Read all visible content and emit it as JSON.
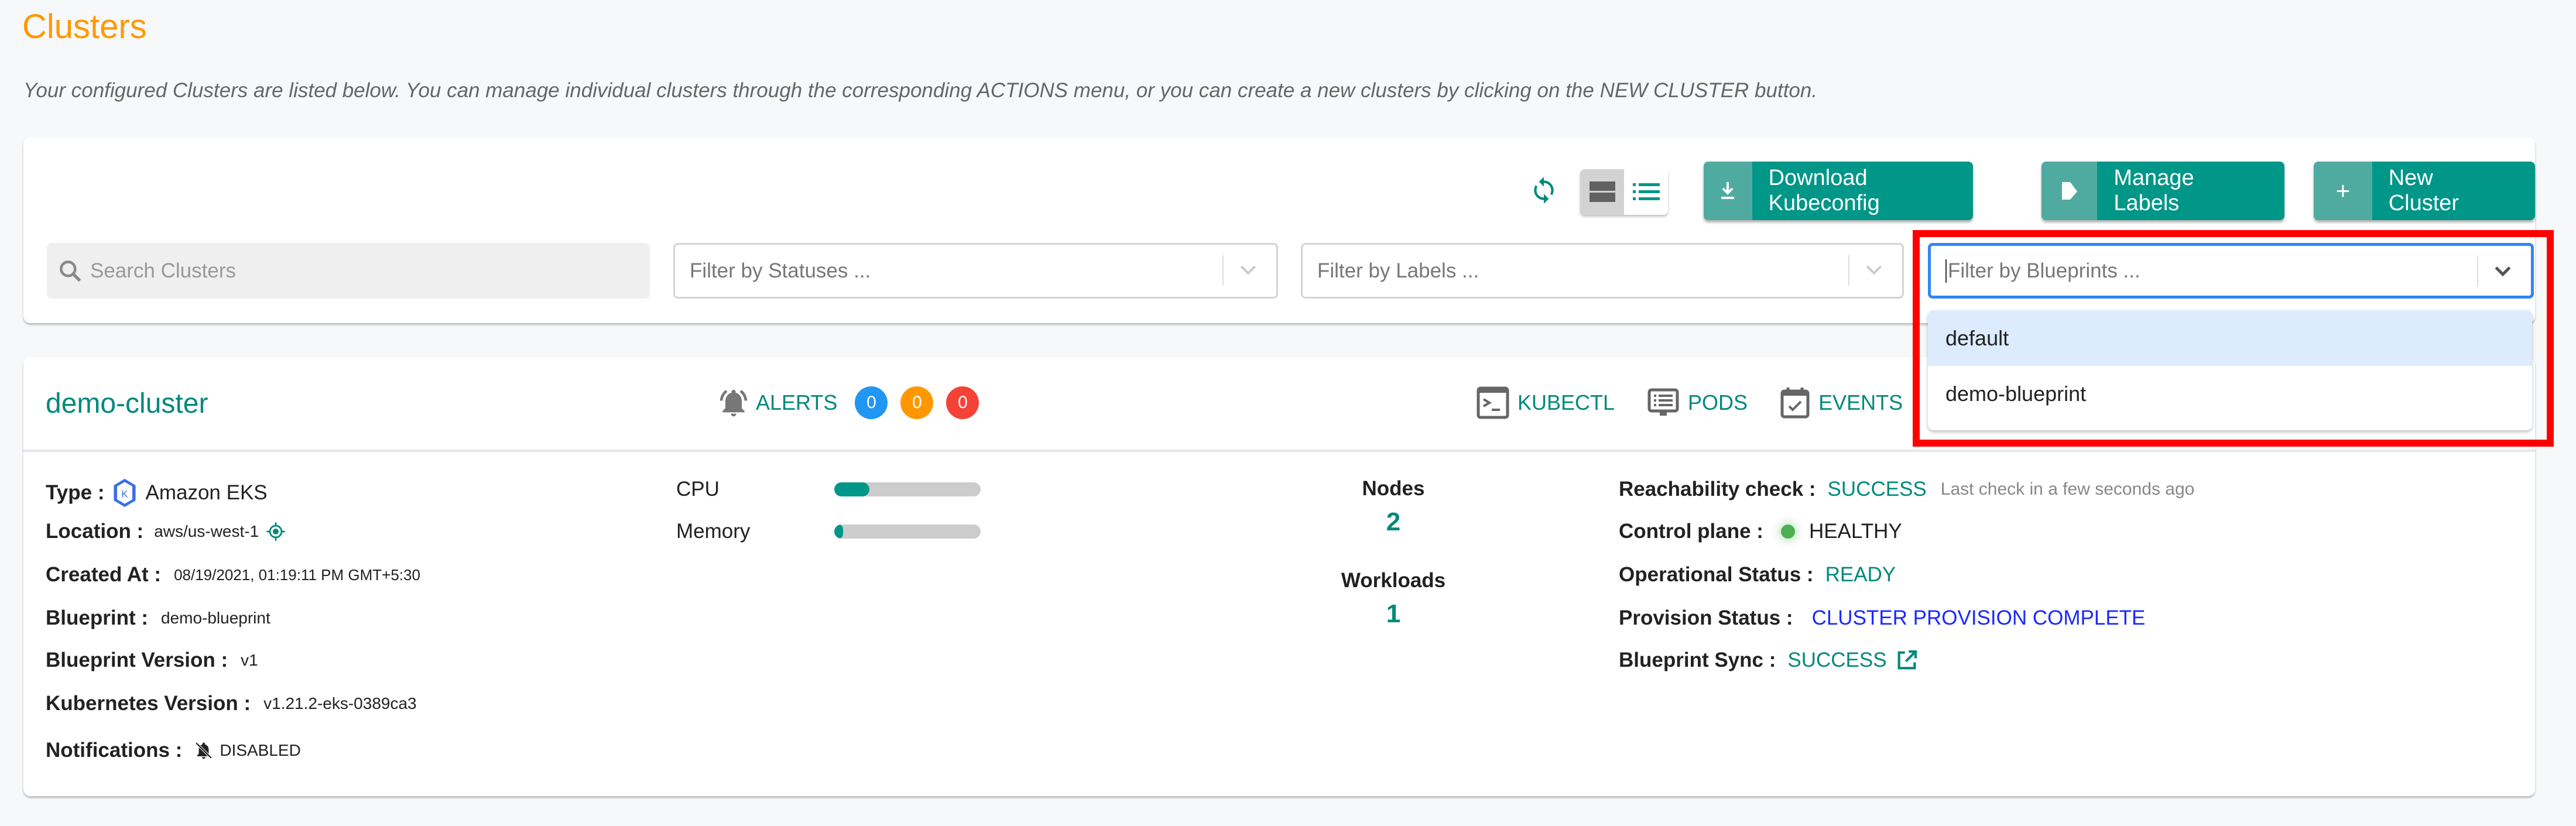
{
  "page": {
    "title": "Clusters",
    "subtitle": "Your configured Clusters are listed below. You can manage individual clusters through the corresponding ACTIONS menu, or you can create a new clusters by clicking on the NEW CLUSTER button."
  },
  "toolbar": {
    "refresh_icon": "refresh-icon",
    "view_toggle": {
      "card_view": "card-view-icon",
      "list_view": "list-view-icon",
      "active": "card"
    },
    "download_kubeconfig": "Download Kubeconfig",
    "manage_labels": "Manage Labels",
    "new_cluster": "New Cluster"
  },
  "filters": {
    "search_placeholder": "Search Clusters",
    "statuses_placeholder": "Filter by Statuses ...",
    "labels_placeholder": "Filter by Labels ...",
    "blueprints_placeholder": "Filter by Blueprints ...",
    "blueprints_options": [
      "default",
      "demo-blueprint"
    ],
    "blueprints_highlighted": "default"
  },
  "cluster": {
    "name": "demo-cluster",
    "alerts_label": "ALERTS",
    "alerts": [
      {
        "count": "0",
        "color": "#2196f3"
      },
      {
        "count": "0",
        "color": "#ff9800"
      },
      {
        "count": "0",
        "color": "#f44336"
      }
    ],
    "actions": {
      "kubectl": "KUBECTL",
      "pods": "PODS",
      "events": "EVENTS"
    },
    "details": {
      "type_label": "Type :",
      "type_value": "Amazon EKS",
      "location_label": "Location :",
      "location_value": "aws/us-west-1",
      "created_label": "Created At :",
      "created_value": "08/19/2021, 01:19:11 PM GMT+5:30",
      "blueprint_label": "Blueprint :",
      "blueprint_value": "demo-blueprint",
      "bp_version_label": "Blueprint Version :",
      "bp_version_value": "v1",
      "k8s_version_label": "Kubernetes Version :",
      "k8s_version_value": "v1.21.2-eks-0389ca3",
      "notifications_label": "Notifications :",
      "notifications_value": "DISABLED"
    },
    "resources": {
      "cpu_label": "CPU",
      "cpu_percent": 24,
      "memory_label": "Memory",
      "memory_percent": 6
    },
    "counts": {
      "nodes_label": "Nodes",
      "nodes_value": "2",
      "workloads_label": "Workloads",
      "workloads_value": "1"
    },
    "status": {
      "reachability_label": "Reachability check :",
      "reachability_value": "SUCCESS",
      "reachability_note": "Last check in a few seconds ago",
      "control_plane_label": "Control plane :",
      "control_plane_value": "HEALTHY",
      "operational_label": "Operational Status :",
      "operational_value": "READY",
      "provision_label": "Provision Status :",
      "provision_value": "CLUSTER PROVISION COMPLETE",
      "bp_sync_label": "Blueprint Sync :",
      "bp_sync_value": "SUCCESS"
    }
  },
  "colors": {
    "accent": "#009688",
    "title": "#ff9800",
    "provision": "#1a28ff",
    "healthy": "#4caf50",
    "focus": "#2d87f5",
    "highlight": "#ff0000"
  }
}
